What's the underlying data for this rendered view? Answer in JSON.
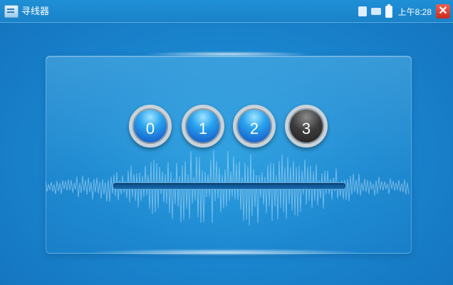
{
  "titlebar": {
    "title": "寻线器",
    "time": "上午8:28",
    "icons": [
      "app-icon",
      "sd-card-icon",
      "network-icon",
      "battery-icon",
      "close-icon"
    ],
    "close_label": "✕",
    "close_color": "#d9362a"
  },
  "pairs": {
    "items": [
      {
        "label": "0",
        "state": "active"
      },
      {
        "label": "1",
        "state": "active"
      },
      {
        "label": "2",
        "state": "active"
      },
      {
        "label": "3",
        "state": "inactive"
      }
    ],
    "active_color": "#2aa3ee",
    "inactive_color": "#2b2b2b"
  },
  "progress": {
    "value": 0
  },
  "colors": {
    "background": "#1a86cf",
    "titlebar": "#1f8fd6"
  }
}
